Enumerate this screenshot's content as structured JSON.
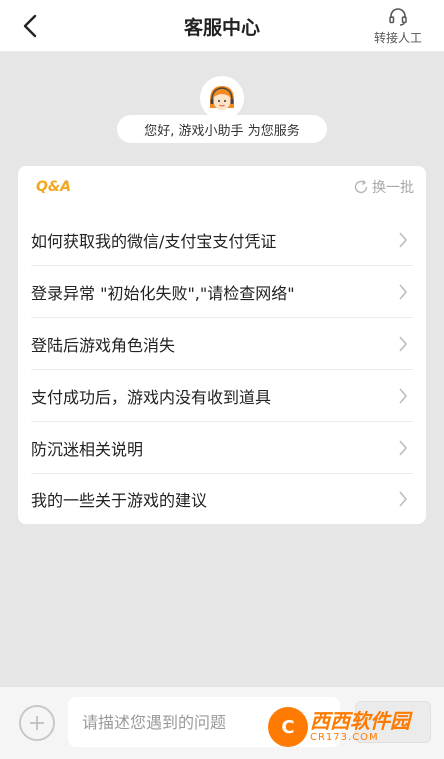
{
  "header": {
    "title": "客服中心",
    "back_icon": "chevron-left-icon",
    "transfer_label": "转接人工",
    "transfer_icon": "headset-icon"
  },
  "greeting": {
    "text": "您好, 游戏小助手 为您服务",
    "avatar_icon": "support-agent-avatar"
  },
  "qa": {
    "logo": "Q&A",
    "refresh_label": "换一批",
    "refresh_icon": "refresh-icon",
    "items": [
      {
        "text": "如何获取我的微信/支付宝支付凭证"
      },
      {
        "text": "登录异常 \"初始化失败\",\"请检查网络\""
      },
      {
        "text": "登陆后游戏角色消失"
      },
      {
        "text": "支付成功后，游戏内没有收到道具"
      },
      {
        "text": "防沉迷相关说明"
      },
      {
        "text": "我的一些关于游戏的建议"
      }
    ]
  },
  "input_bar": {
    "placeholder": "请描述您遇到的问题",
    "value": ""
  },
  "watermark": {
    "main": "西西软件园",
    "sub": "CR173.COM"
  },
  "colors": {
    "accent": "#f2a51e",
    "background": "#e6e6e6",
    "watermark": "#ff7a00"
  }
}
